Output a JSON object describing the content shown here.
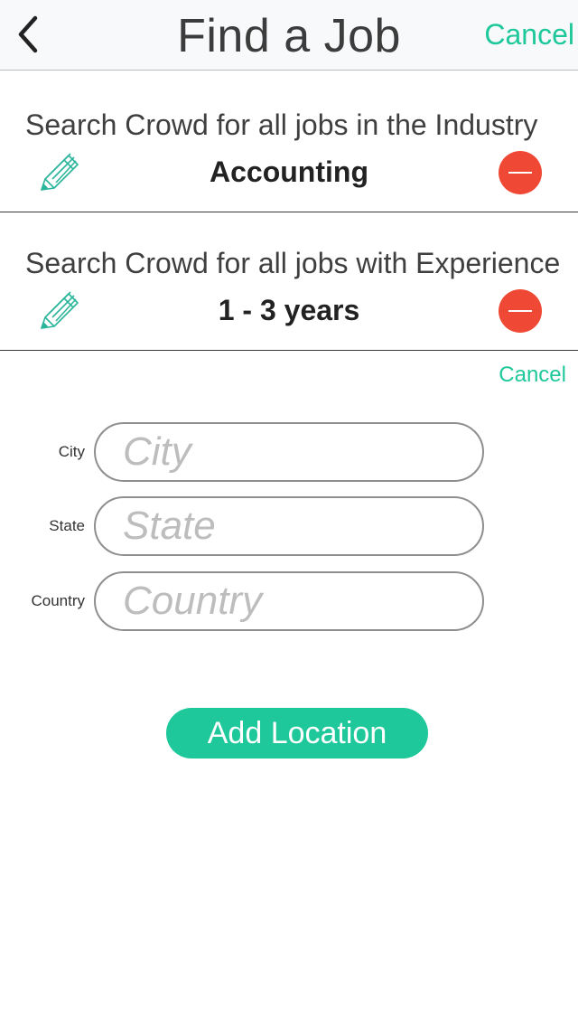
{
  "navbar": {
    "back_icon": "chevron-left-icon",
    "title": "Find a Job",
    "cancel_label": "Cancel"
  },
  "criteria": [
    {
      "heading": "Search Crowd for all jobs in the Industry",
      "value": "Accounting",
      "edit_icon": "pencil-icon",
      "remove_icon": "minus-circle-icon"
    },
    {
      "heading": "Search Crowd for all jobs with Experience",
      "value": "1 - 3 years",
      "edit_icon": "pencil-icon",
      "remove_icon": "minus-circle-icon"
    }
  ],
  "location_form": {
    "cancel_label": "Cancel",
    "fields": [
      {
        "label": "City",
        "placeholder": "City",
        "value": ""
      },
      {
        "label": "State",
        "placeholder": "State",
        "value": ""
      },
      {
        "label": "Country",
        "placeholder": "Country",
        "value": ""
      }
    ],
    "submit_label": "Add Location"
  },
  "colors": {
    "accent": "#1ec89a",
    "remove": "#ef4935",
    "navbar_bg": "#f7f9fb",
    "pencil": "#2bb59b"
  }
}
